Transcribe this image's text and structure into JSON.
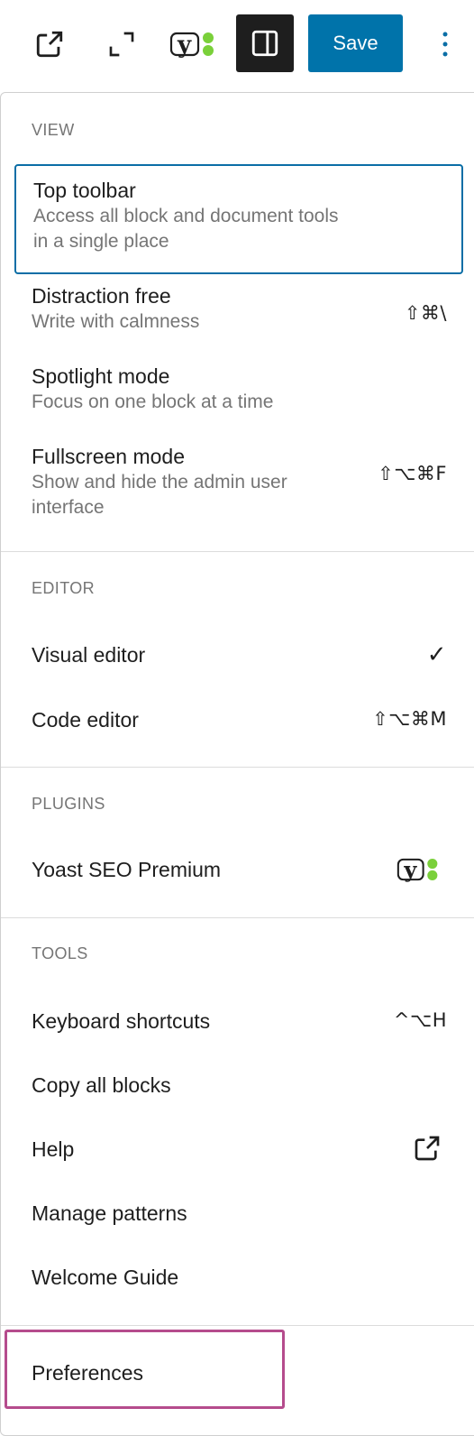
{
  "toolbar": {
    "save_label": "Save",
    "icons": [
      "external-link-icon",
      "fullscreen-icon",
      "yoast-icon",
      "sidebar-toggle-icon",
      "more-options-icon"
    ]
  },
  "menu": {
    "view": {
      "label": "VIEW",
      "items": [
        {
          "title": "Top toolbar",
          "desc": "Access all block and document tools in a single place",
          "shortcut": ""
        },
        {
          "title": "Distraction free",
          "desc": "Write with calmness",
          "shortcut": "⇧⌘\\"
        },
        {
          "title": "Spotlight mode",
          "desc": "Focus on one block at a time",
          "shortcut": ""
        },
        {
          "title": "Fullscreen mode",
          "desc": "Show and hide the admin user interface",
          "shortcut": "⇧⌥⌘F"
        }
      ]
    },
    "editor": {
      "label": "EDITOR",
      "items": [
        {
          "title": "Visual editor",
          "shortcut": "✓"
        },
        {
          "title": "Code editor",
          "shortcut": "⇧⌥⌘M"
        }
      ]
    },
    "plugins": {
      "label": "PLUGINS",
      "items": [
        {
          "title": "Yoast SEO Premium",
          "icon": "yoast-icon"
        }
      ]
    },
    "tools": {
      "label": "TOOLS",
      "items": [
        {
          "title": "Keyboard shortcuts",
          "shortcut": "^⌥H"
        },
        {
          "title": "Copy all blocks",
          "shortcut": ""
        },
        {
          "title": "Help",
          "icon": "external-link-icon"
        },
        {
          "title": "Manage patterns",
          "shortcut": ""
        },
        {
          "title": "Welcome Guide",
          "shortcut": ""
        }
      ]
    },
    "preferences": {
      "title": "Preferences"
    }
  },
  "colors": {
    "accent": "#0073aa",
    "focus": "#0a6ea6",
    "highlight": "#b54c8d",
    "yoast_green": "#7ad03a"
  }
}
